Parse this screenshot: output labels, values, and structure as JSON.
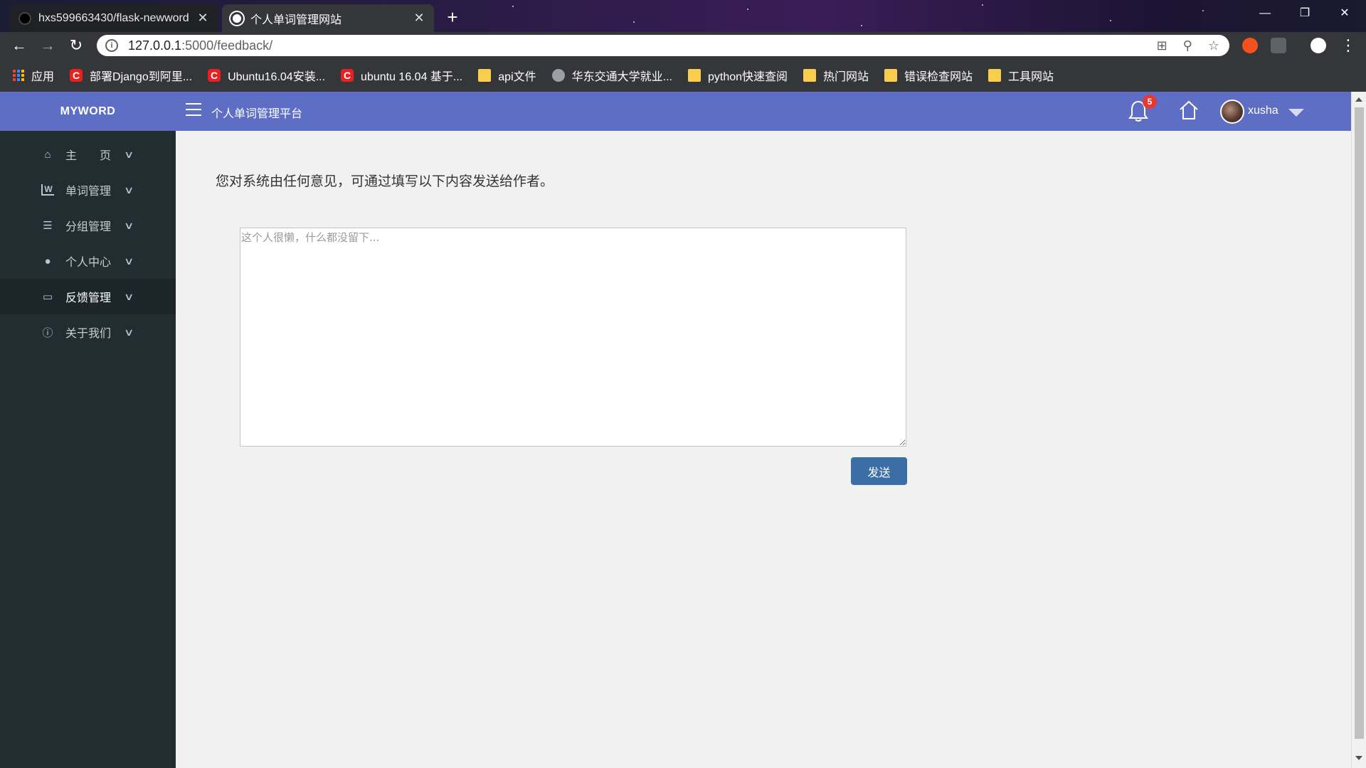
{
  "browser": {
    "tabs": [
      {
        "title": "hxs599663430/flask-newword",
        "active": false
      },
      {
        "title": "个人单词管理网站",
        "active": true
      }
    ],
    "close_glyph": "✕",
    "newtab_glyph": "+",
    "window_controls": {
      "minimize": "—",
      "restore": "❐",
      "close": "✕"
    },
    "url_host": "127.0.0.1",
    "url_path": ":5000/feedback/",
    "bookmarks": [
      {
        "label": "应用",
        "icon": "apps-grid-icon"
      },
      {
        "label": "部署Django到阿里...",
        "icon": "csdn-icon"
      },
      {
        "label": "Ubuntu16.04安装...",
        "icon": "csdn-icon"
      },
      {
        "label": "ubuntu 16.04 基于...",
        "icon": "csdn-icon"
      },
      {
        "label": "api文件",
        "icon": "folder-icon"
      },
      {
        "label": "华东交通大学就业...",
        "icon": "globe-icon"
      },
      {
        "label": "python快速查阅",
        "icon": "folder-icon"
      },
      {
        "label": "热门网站",
        "icon": "folder-icon"
      },
      {
        "label": "错误检查网站",
        "icon": "folder-icon"
      },
      {
        "label": "工具网站",
        "icon": "folder-icon"
      }
    ]
  },
  "app": {
    "brand": "MYWORD",
    "platform_title": "个人单词管理平台",
    "notification_count": "5",
    "username": "xusha",
    "colors": {
      "primary": "#5e6ec5",
      "sidebar": "#222d32",
      "button": "#3a6ea5",
      "badge": "#e53935"
    },
    "sidebar": [
      {
        "label": "主　　页",
        "icon": "home-icon",
        "glyph": "⌂"
      },
      {
        "label": "单词管理",
        "icon": "word-icon",
        "glyph": "W"
      },
      {
        "label": "分组管理",
        "icon": "list-icon",
        "glyph": "☰"
      },
      {
        "label": "个人中心",
        "icon": "user-icon",
        "glyph": "●"
      },
      {
        "label": "反馈管理",
        "icon": "feedback-icon",
        "glyph": "▭",
        "active": true
      },
      {
        "label": "关于我们",
        "icon": "info-icon",
        "glyph": "ⓘ"
      }
    ],
    "chevron_glyph": "∨"
  },
  "feedback": {
    "intro": "您对系统由任何意见，可通过填写以下内容发送给作者。",
    "placeholder": "这个人很懒，什么都没留下...",
    "value": "",
    "send_label": "发送"
  }
}
